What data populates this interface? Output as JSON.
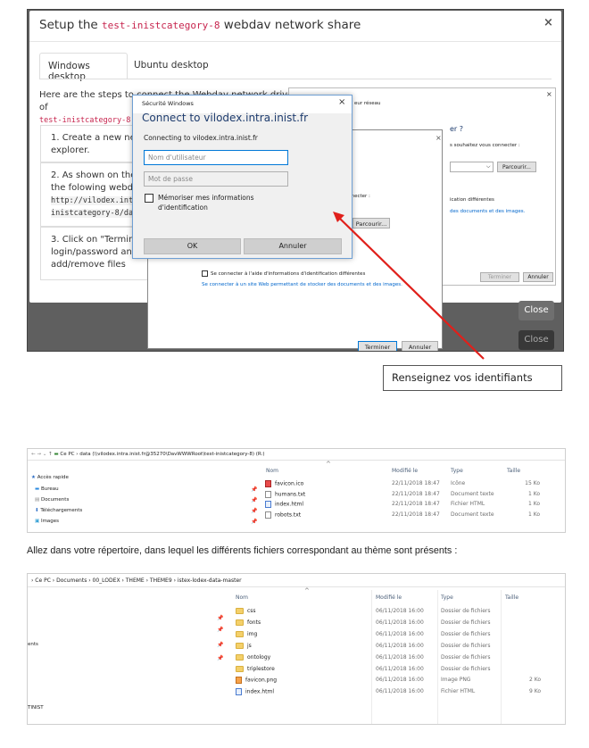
{
  "modal": {
    "title_prefix": "Setup the ",
    "title_code": "test-inistcategory-8",
    "title_suffix": " webdav network share",
    "close_x": "×",
    "tabs": [
      {
        "label": "Windows desktop"
      },
      {
        "label": "Ubuntu desktop"
      }
    ],
    "intro_visible": "Here are the steps to co",
    "intro_visible_2": "nnect the Webdav network drive of",
    "intro_code": "test-inistcategory-8",
    "intro_end": " on",
    "step1": "1. Create a new netw",
    "step1b": "explorer.",
    "step2": "2. As shown on the sc",
    "step2b": "the folowing webdav",
    "step2_code1": "http://vilodex.intra",
    "step2_code2": "inistcategory-8/data",
    "step3": "3. Click on \"Terminer\"",
    "step3b": "login/password and e",
    "step3c": "add/remove files",
    "close_button": "Close"
  },
  "background_dialog": {
    "x": "×",
    "line1": "eur réseau",
    "line2": "er ?",
    "line3": "s souhaitez vous connecter :",
    "browse": "Parcourir...",
    "line4": "ication différentes",
    "line5": "des documents et des images.",
    "finish": "Terminer",
    "cancel": "Annuler"
  },
  "foreground_dialog": {
    "x": "×",
    "line1": "vous connecter :",
    "browse": "Parcourir...",
    "checkbox_label": "Se connecter à l'aide d'informations d'identification différentes",
    "link": "Se connecter à un site Web permettant de stocker des documents et des images.",
    "finish": "Terminer",
    "cancel": "Annuler"
  },
  "security": {
    "header": "Sécurité Windows",
    "close_x": "×",
    "title": "Connect to vilodex.intra.inist.fr",
    "host_line": "Connecting to vilodex.intra.inist.fr",
    "username_placeholder": "Nom d'utilisateur",
    "password_placeholder": "Mot de passe",
    "remember_label": "Mémoriser mes informations d'identification",
    "ok": "OK",
    "cancel": "Annuler"
  },
  "callout": {
    "text": "Renseignez vos identifiants",
    "arrow_color": "#e0201b"
  },
  "explorer1": {
    "address": "Ce PC  ›  data (\\\\vilodex.intra.inist.fr@35270\\DavWWWRoot\\test-inistcategory-8) (R:)",
    "nav": [
      {
        "label": "Accès rapide"
      },
      {
        "label": "Bureau"
      },
      {
        "label": "Documents"
      },
      {
        "label": "Téléchargements"
      },
      {
        "label": "Images"
      }
    ],
    "columns": {
      "name": "Nom",
      "date": "Modifié le",
      "type": "Type",
      "size": "Taille"
    },
    "rows": [
      {
        "name": "favicon.ico",
        "date": "22/11/2018 18:47",
        "type": "Icône",
        "size": "15 Ko",
        "icon": "ico"
      },
      {
        "name": "humans.txt",
        "date": "22/11/2018 18:47",
        "type": "Document texte",
        "size": "1 Ko",
        "icon": "file"
      },
      {
        "name": "index.html",
        "date": "22/11/2018 18:47",
        "type": "Fichier HTML",
        "size": "1 Ko",
        "icon": "html"
      },
      {
        "name": "robots.txt",
        "date": "22/11/2018 18:47",
        "type": "Document texte",
        "size": "1 Ko",
        "icon": "file"
      }
    ]
  },
  "instruction": "Allez dans votre répertoire, dans lequel les différents fichiers correspondant au thème sont présents :",
  "explorer2": {
    "address": "›  Ce PC  ›  Documents  ›  00_LODEX  ›  THEME  ›  THEME9  ›  istex-lodex-data-master",
    "nav": [
      {
        "label": "ents"
      },
      {
        "label": "TINIST"
      }
    ],
    "columns": {
      "name": "Nom",
      "date": "Modifié le",
      "type": "Type",
      "size": "Taille"
    },
    "rows": [
      {
        "name": "css",
        "date": "06/11/2018 16:00",
        "type": "Dossier de fichiers",
        "size": "",
        "icon": "folder"
      },
      {
        "name": "fonts",
        "date": "06/11/2018 16:00",
        "type": "Dossier de fichiers",
        "size": "",
        "icon": "folder"
      },
      {
        "name": "img",
        "date": "06/11/2018 16:00",
        "type": "Dossier de fichiers",
        "size": "",
        "icon": "folder"
      },
      {
        "name": "js",
        "date": "06/11/2018 16:00",
        "type": "Dossier de fichiers",
        "size": "",
        "icon": "folder"
      },
      {
        "name": "ontology",
        "date": "06/11/2018 16:00",
        "type": "Dossier de fichiers",
        "size": "",
        "icon": "folder"
      },
      {
        "name": "triplestore",
        "date": "06/11/2018 16:00",
        "type": "Dossier de fichiers",
        "size": "",
        "icon": "folder"
      },
      {
        "name": "favicon.png",
        "date": "06/11/2018 16:00",
        "type": "Image PNG",
        "size": "2 Ko",
        "icon": "png"
      },
      {
        "name": "index.html",
        "date": "06/11/2018 16:00",
        "type": "Fichier HTML",
        "size": "9 Ko",
        "icon": "html"
      }
    ]
  }
}
